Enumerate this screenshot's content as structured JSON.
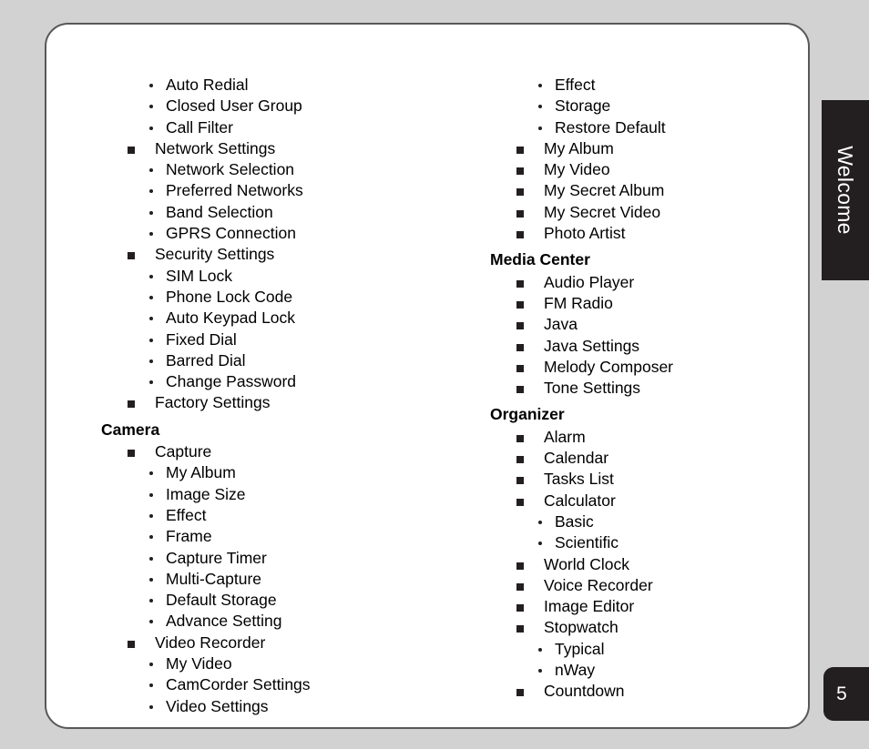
{
  "page": {
    "number": "5",
    "background_color": "#d2d2d2",
    "card_color": "#ffffff",
    "card_border_color": "#58585a",
    "accent_color": "#231f20"
  },
  "side_tab": {
    "label": "Welcome",
    "background_color": "#231f20",
    "text_color": "#ffffff"
  },
  "columns": {
    "left": {
      "blocks": [
        {
          "header": null,
          "items": [
            {
              "level": 2,
              "label": "Auto Redial"
            },
            {
              "level": 2,
              "label": "Closed User Group"
            },
            {
              "level": 2,
              "label": "Call Filter"
            },
            {
              "level": 1,
              "label": "Network Settings"
            },
            {
              "level": 2,
              "label": "Network Selection"
            },
            {
              "level": 2,
              "label": "Preferred Networks"
            },
            {
              "level": 2,
              "label": "Band Selection"
            },
            {
              "level": 2,
              "label": "GPRS Connection"
            },
            {
              "level": 1,
              "label": "Security Settings"
            },
            {
              "level": 2,
              "label": "SIM Lock"
            },
            {
              "level": 2,
              "label": "Phone Lock Code"
            },
            {
              "level": 2,
              "label": "Auto Keypad Lock"
            },
            {
              "level": 2,
              "label": "Fixed Dial"
            },
            {
              "level": 2,
              "label": "Barred Dial"
            },
            {
              "level": 2,
              "label": "Change Password"
            },
            {
              "level": 1,
              "label": "Factory Settings"
            }
          ]
        },
        {
          "header": "Camera",
          "items": [
            {
              "level": 1,
              "label": "Capture"
            },
            {
              "level": 2,
              "label": "My Album"
            },
            {
              "level": 2,
              "label": "Image Size"
            },
            {
              "level": 2,
              "label": "Effect"
            },
            {
              "level": 2,
              "label": "Frame"
            },
            {
              "level": 2,
              "label": "Capture Timer"
            },
            {
              "level": 2,
              "label": "Multi-Capture"
            },
            {
              "level": 2,
              "label": "Default Storage"
            },
            {
              "level": 2,
              "label": "Advance Setting"
            },
            {
              "level": 1,
              "label": "Video Recorder"
            },
            {
              "level": 2,
              "label": "My Video"
            },
            {
              "level": 2,
              "label": "CamCorder Settings"
            },
            {
              "level": 2,
              "label": "Video Settings"
            }
          ]
        }
      ]
    },
    "right": {
      "blocks": [
        {
          "header": null,
          "items": [
            {
              "level": 2,
              "label": "Effect"
            },
            {
              "level": 2,
              "label": "Storage"
            },
            {
              "level": 2,
              "label": "Restore Default"
            },
            {
              "level": 1,
              "label": "My Album"
            },
            {
              "level": 1,
              "label": "My Video"
            },
            {
              "level": 1,
              "label": "My Secret Album"
            },
            {
              "level": 1,
              "label": "My Secret Video"
            },
            {
              "level": 1,
              "label": "Photo Artist"
            }
          ]
        },
        {
          "header": "Media Center",
          "items": [
            {
              "level": 1,
              "label": "Audio Player"
            },
            {
              "level": 1,
              "label": "FM Radio"
            },
            {
              "level": 1,
              "label": "Java"
            },
            {
              "level": 1,
              "label": "Java Settings"
            },
            {
              "level": 1,
              "label": "Melody Composer"
            },
            {
              "level": 1,
              "label": "Tone Settings"
            }
          ]
        },
        {
          "header": "Organizer",
          "items": [
            {
              "level": 1,
              "label": "Alarm"
            },
            {
              "level": 1,
              "label": "Calendar"
            },
            {
              "level": 1,
              "label": "Tasks List"
            },
            {
              "level": 1,
              "label": "Calculator"
            },
            {
              "level": 2,
              "label": "Basic"
            },
            {
              "level": 2,
              "label": "Scientific"
            },
            {
              "level": 1,
              "label": "World Clock"
            },
            {
              "level": 1,
              "label": "Voice Recorder"
            },
            {
              "level": 1,
              "label": "Image Editor"
            },
            {
              "level": 1,
              "label": "Stopwatch"
            },
            {
              "level": 2,
              "label": "Typical"
            },
            {
              "level": 2,
              "label": "nWay"
            },
            {
              "level": 1,
              "label": "Countdown"
            }
          ]
        }
      ]
    }
  }
}
